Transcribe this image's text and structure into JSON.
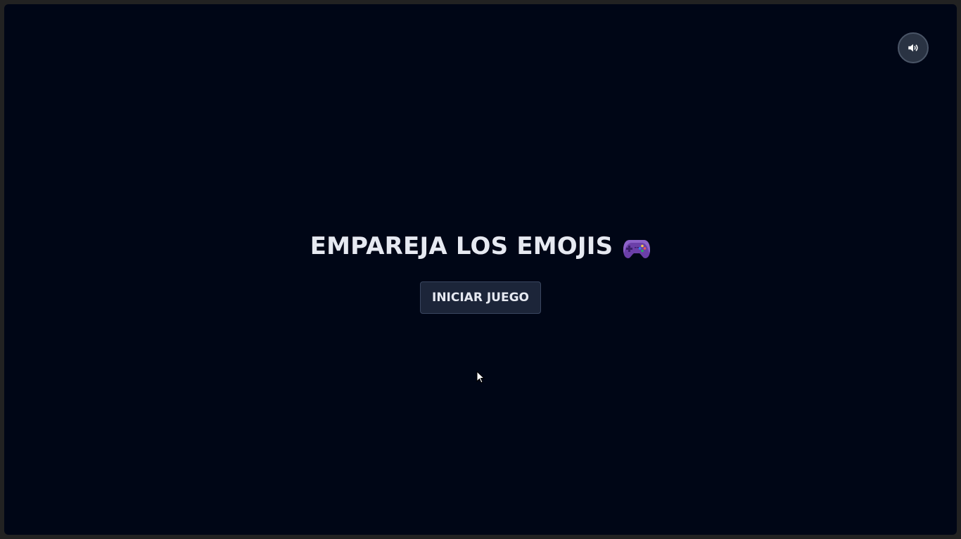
{
  "menu": {
    "title": "EMPAREJA LOS EMOJIS",
    "title_icon": "video-game-controller-icon",
    "start_button_label": "INICIAR JUEGO"
  },
  "controls": {
    "sound_icon": "speaker-icon"
  },
  "colors": {
    "background": "#000616",
    "button_background": "#1c2539",
    "text": "#e6e9f1",
    "controller": "#6b3fa8"
  }
}
